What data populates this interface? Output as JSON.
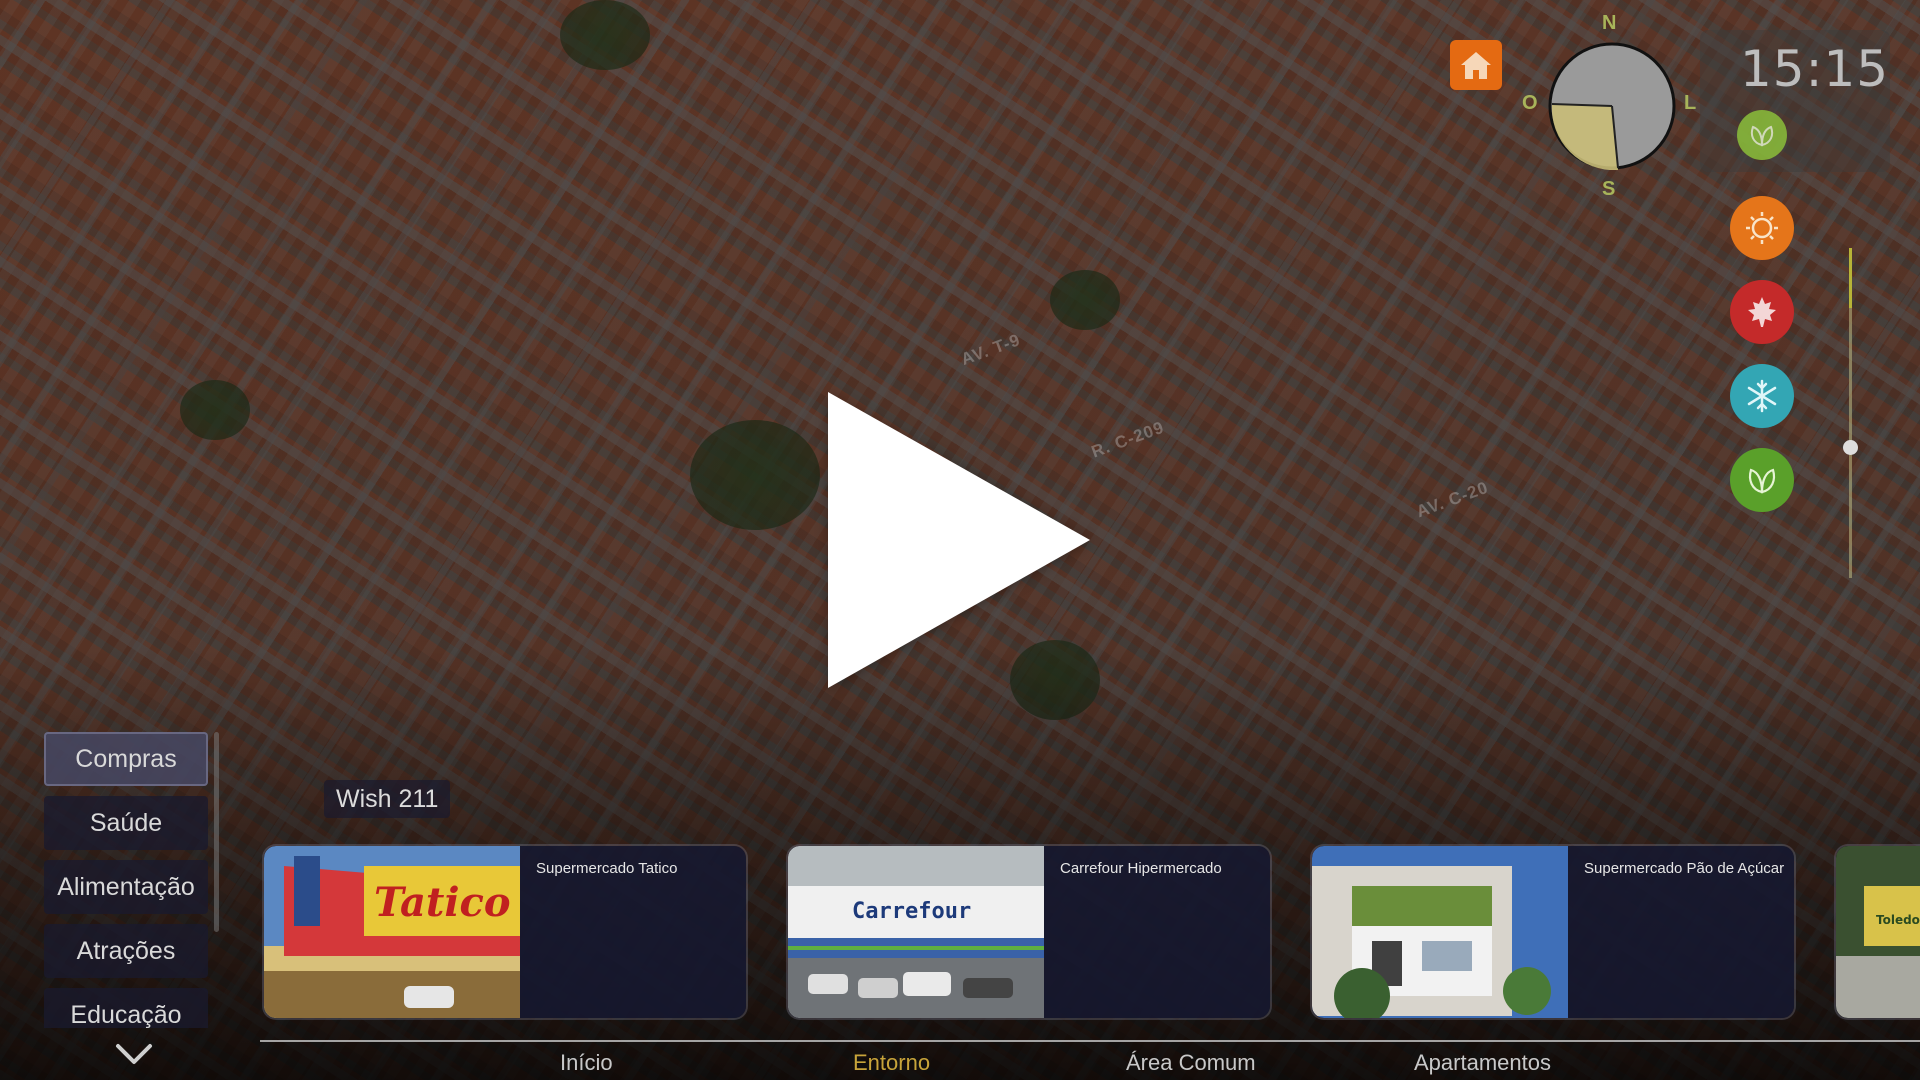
{
  "map": {
    "street_labels": [
      "AV. T-9",
      "R. C-209",
      "AV. C-20"
    ]
  },
  "hud": {
    "clock": "15:15",
    "compass": {
      "north": "N",
      "south": "S",
      "east": "L",
      "west": "O"
    },
    "home_icon": "home-icon",
    "seasons": [
      {
        "name": "leaf-icon",
        "color": "#8bbf3a"
      },
      {
        "name": "sun-icon",
        "color": "#e5751a"
      },
      {
        "name": "maple-leaf-icon",
        "color": "#c42a2a"
      },
      {
        "name": "snowflake-icon",
        "color": "#33a6b4"
      },
      {
        "name": "leaf-icon",
        "color": "#5aa02a"
      }
    ],
    "accent_color": "#e46a12"
  },
  "categories": {
    "items": [
      "Compras",
      "Saúde",
      "Alimentação",
      "Atrações",
      "Educação"
    ],
    "selected": "Compras"
  },
  "place_badge": "Wish 211",
  "cards": [
    {
      "title": "Supermercado Tatico",
      "sign": "Tatico"
    },
    {
      "title": "Carrefour Hipermercado",
      "sign": "Carrefour"
    },
    {
      "title": "Supermercado Pão de Açúcar",
      "sign": ""
    },
    {
      "title": "",
      "sign": "Toledo"
    }
  ],
  "nav": {
    "items": [
      "Início",
      "Entorno",
      "Área Comum",
      "Apartamentos"
    ],
    "active": "Entorno",
    "active_color": "#c8a43a"
  }
}
